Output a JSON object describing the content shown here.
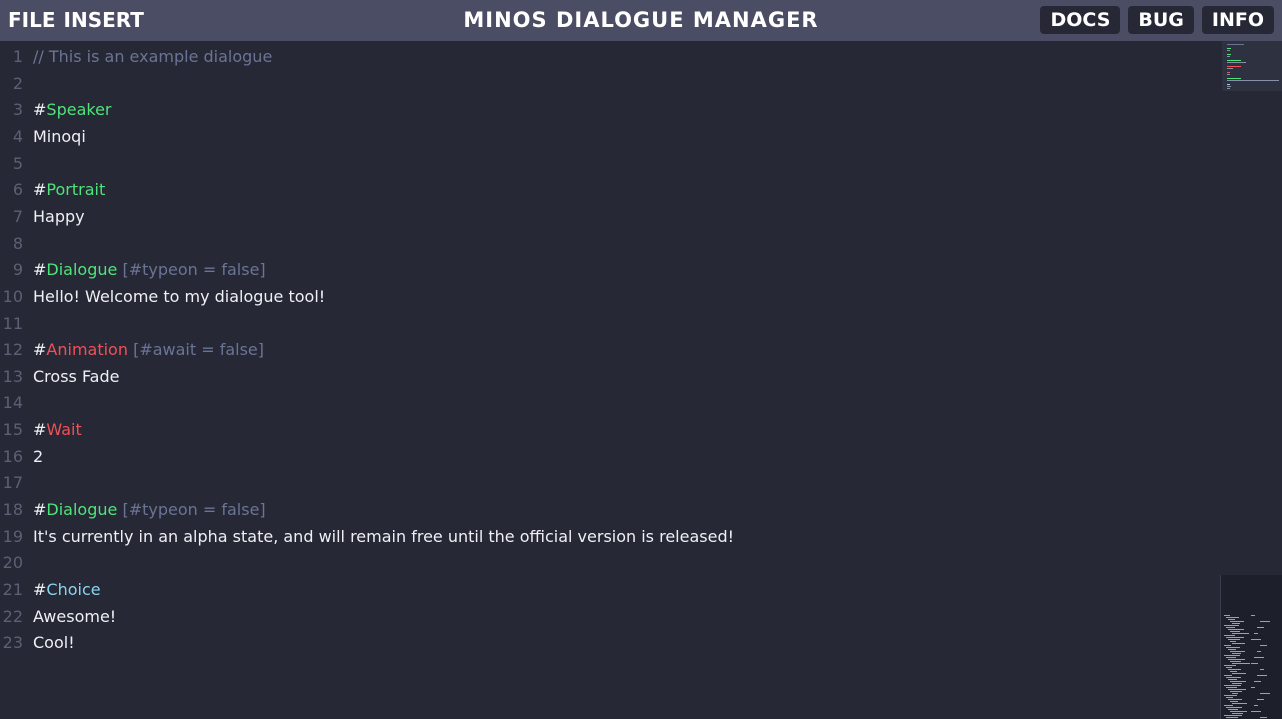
{
  "menu": {
    "file": "FILE",
    "insert": "INSERT"
  },
  "app_title": "MINOS DIALOGUE MANAGER",
  "nav": {
    "docs": "DOCS",
    "bug": "BUG",
    "info": "INFO"
  },
  "colors": {
    "topbar": "#4a4d64",
    "editor_bg": "#262835",
    "keyword_green": "#4ee47a",
    "keyword_red": "#ef5159",
    "keyword_cyan": "#8bd4ee",
    "comment": "#6b7494"
  },
  "editor": {
    "lines": [
      {
        "num": "1",
        "comment": "// This is an example dialogue"
      },
      {
        "num": "2"
      },
      {
        "num": "3",
        "hash": "#",
        "keyword": "Speaker",
        "kind": "green"
      },
      {
        "num": "4",
        "text": "Minoqi"
      },
      {
        "num": "5"
      },
      {
        "num": "6",
        "hash": "#",
        "keyword": "Portrait",
        "kind": "green"
      },
      {
        "num": "7",
        "text": "Happy"
      },
      {
        "num": "8"
      },
      {
        "num": "9",
        "hash": "#",
        "keyword": "Dialogue",
        "kind": "green",
        "param": " [#typeon = false]"
      },
      {
        "num": "10",
        "text": "Hello! Welcome to my dialogue tool!"
      },
      {
        "num": "11"
      },
      {
        "num": "12",
        "hash": "#",
        "keyword": "Animation",
        "kind": "red",
        "param": " [#await = false]"
      },
      {
        "num": "13",
        "text": "Cross Fade"
      },
      {
        "num": "14"
      },
      {
        "num": "15",
        "hash": "#",
        "keyword": "Wait",
        "kind": "red"
      },
      {
        "num": "16",
        "text": "2"
      },
      {
        "num": "17"
      },
      {
        "num": "18",
        "hash": "#",
        "keyword": "Dialogue",
        "kind": "green",
        "param": " [#typeon = false]"
      },
      {
        "num": "19",
        "text": "It's currently in an alpha state, and will remain free until the official version is released!"
      },
      {
        "num": "20"
      },
      {
        "num": "21",
        "hash": "#",
        "keyword": "Choice",
        "kind": "cyan"
      },
      {
        "num": "22",
        "text": "Awesome!"
      },
      {
        "num": "23",
        "text": "Cool!"
      }
    ]
  }
}
